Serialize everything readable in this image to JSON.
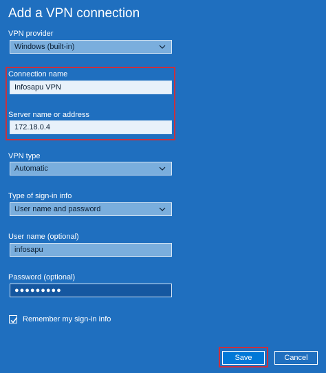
{
  "page": {
    "title": "Add a VPN connection"
  },
  "form": {
    "vpn_provider": {
      "label": "VPN provider",
      "value": "Windows (built-in)"
    },
    "connection_name": {
      "label": "Connection name",
      "value": "Infosapu VPN"
    },
    "server": {
      "label": "Server name or address",
      "value": "172.18.0.4"
    },
    "vpn_type": {
      "label": "VPN type",
      "value": "Automatic"
    },
    "signin_type": {
      "label": "Type of sign-in info",
      "value": "User name and password"
    },
    "username": {
      "label": "User name (optional)",
      "value": "infosapu"
    },
    "password": {
      "label": "Password (optional)",
      "value": "●●●●●●●●●"
    },
    "remember": {
      "label": "Remember my sign-in info",
      "checked": true
    }
  },
  "buttons": {
    "save": "Save",
    "cancel": "Cancel"
  },
  "colors": {
    "background": "#1f6fbf",
    "highlight": "#c9303e",
    "save_button": "#0078d7"
  },
  "icons": {
    "dropdown": "chevron-down-icon",
    "checkbox": "checkmark-icon"
  }
}
